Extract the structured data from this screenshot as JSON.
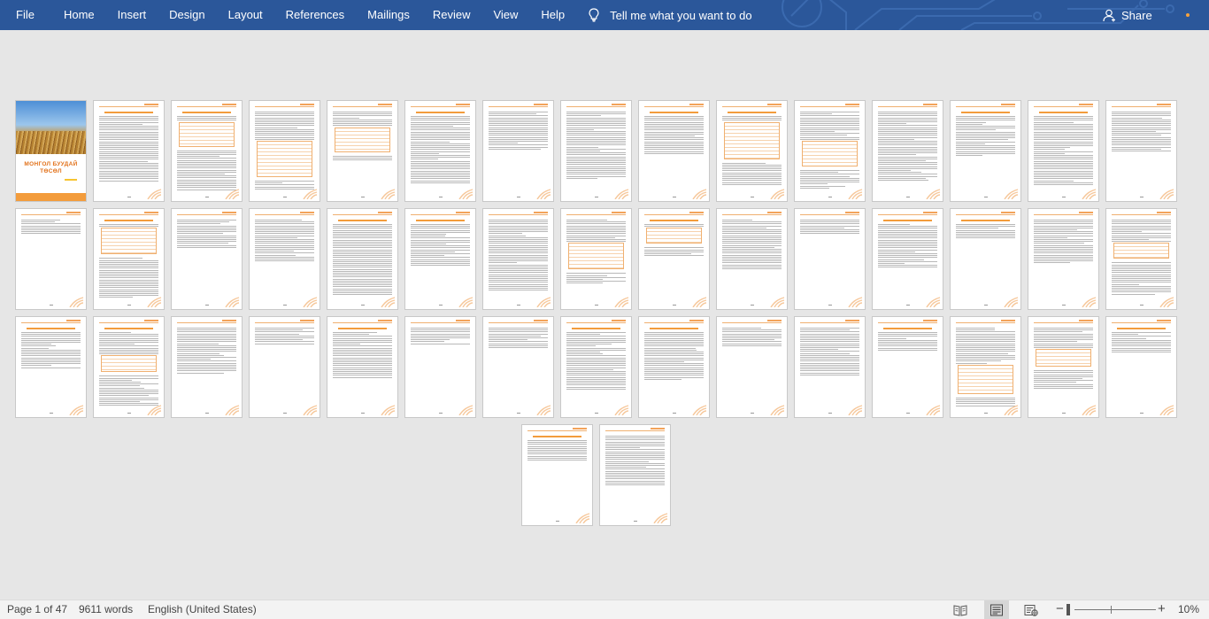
{
  "ribbon": {
    "tabs": [
      "File",
      "Home",
      "Insert",
      "Design",
      "Layout",
      "References",
      "Mailings",
      "Review",
      "View",
      "Help"
    ],
    "tell_me": "Tell me what you want to do",
    "share": "Share",
    "accent": "#2b579a"
  },
  "cover": {
    "title_line1": "МОНГОЛ БУУДАЙ",
    "title_line2": "ТӨСӨЛ"
  },
  "document": {
    "accent": "#f39c3c",
    "page_count": 47
  },
  "status": {
    "page": "Page 1 of 47",
    "words": "9611 words",
    "language": "English (United States)",
    "zoom": "10%"
  }
}
